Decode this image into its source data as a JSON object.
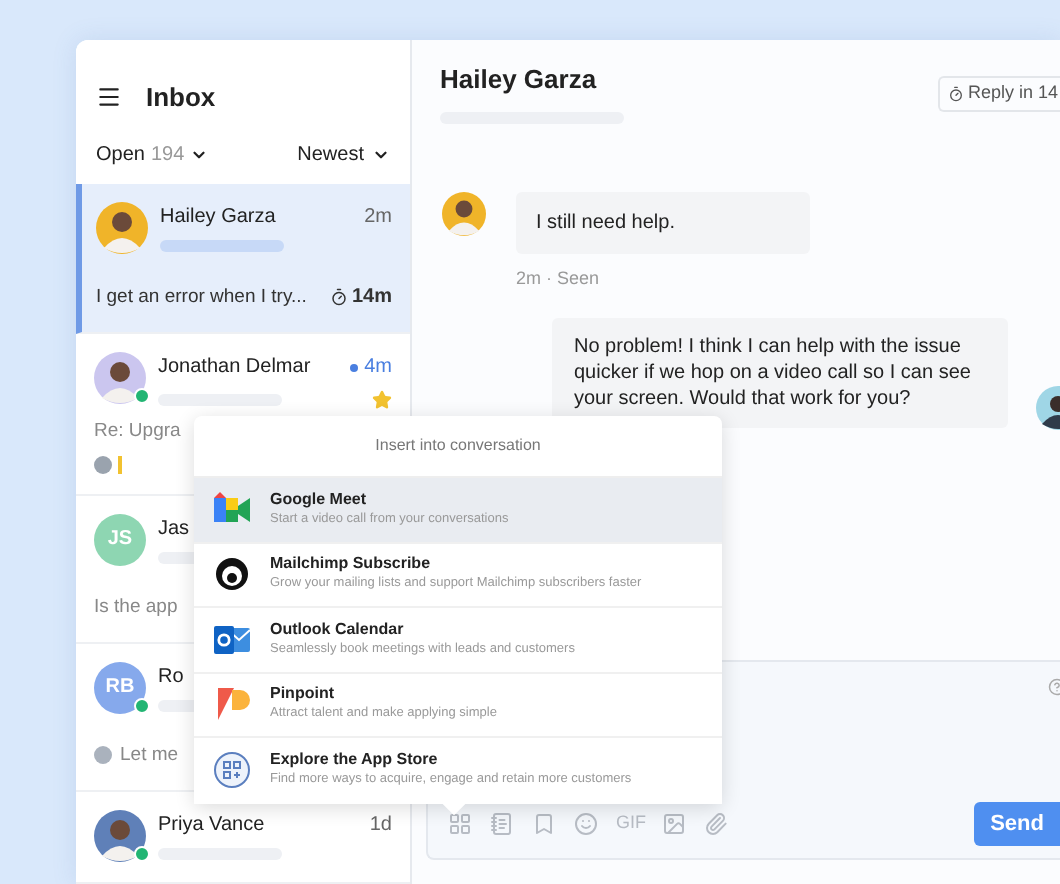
{
  "sidebar": {
    "title": "Inbox",
    "filter": {
      "label": "Open",
      "count": "194"
    },
    "sort": "Newest",
    "conversations": [
      {
        "name": "Hailey Garza",
        "time": "2m",
        "preview": "I get an error when I try...",
        "timer": "14m",
        "selected": true,
        "unread": false,
        "starred": false,
        "online": false,
        "attachment_line": false,
        "preview_icon": false,
        "avatar": {
          "kind": "photo"
        }
      },
      {
        "name": "Jonathan Delmar",
        "time": "4m",
        "preview": "Re: Upgra",
        "selected": false,
        "unread": true,
        "starred": true,
        "online": true,
        "attachment_line": true,
        "preview_icon": false,
        "avatar": {
          "kind": "photo"
        }
      },
      {
        "name": "Jas",
        "preview": "Is the app",
        "selected": false,
        "online": false,
        "attachment_line": false,
        "preview_icon": false,
        "avatar": {
          "kind": "initials",
          "initials": "JS",
          "color": "#8ed6b2"
        }
      },
      {
        "name": "Ro",
        "preview": "Let me",
        "selected": false,
        "online": true,
        "attachment_line": false,
        "preview_icon": true,
        "avatar": {
          "kind": "initials",
          "initials": "RB",
          "color": "#86a9ec"
        }
      },
      {
        "name": "Priya Vance",
        "time": "1d",
        "selected": false,
        "unread": false,
        "starred": false,
        "online": true,
        "attachment_line": false,
        "preview_icon": false,
        "avatar": {
          "kind": "photo"
        }
      }
    ]
  },
  "conversation": {
    "title": "Hailey Garza",
    "reply_button": "Reply in 14",
    "messages": [
      {
        "kind": "customer",
        "text": "I still need help.",
        "meta": "2m · Seen"
      },
      {
        "kind": "agent",
        "text": "No problem! I think I can help with the issue quicker if we hop on a video call so I can see your screen. Would that work for you?"
      }
    ]
  },
  "insert_menu": {
    "title": "Insert into conversation",
    "items": [
      {
        "kind": "meet",
        "name": "Google Meet",
        "description": "Start a video call from your conversations",
        "selected": true
      },
      {
        "kind": "mailchimp",
        "name": "Mailchimp Subscribe",
        "description": "Grow your mailing lists and support Mailchimp subscribers faster",
        "selected": false
      },
      {
        "kind": "outlook",
        "name": "Outlook Calendar",
        "description": "Seamlessly book meetings with leads and customers",
        "selected": false
      },
      {
        "kind": "pinpoint",
        "name": "Pinpoint",
        "description": "Attract talent and make applying simple",
        "selected": false
      },
      {
        "kind": "appstore",
        "name": "Explore the App Store",
        "description": "Find more ways to acquire, engage and retain more customers",
        "selected": false
      }
    ]
  },
  "composer": {
    "gif_label": "GIF",
    "send": "Send"
  }
}
